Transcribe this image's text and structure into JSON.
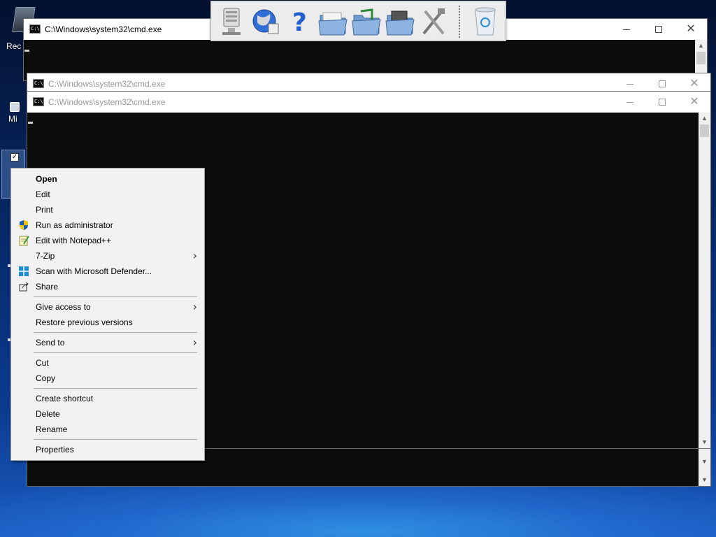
{
  "desktop": {
    "recycle_label": "Rec",
    "mi_label": "Mi"
  },
  "windows": [
    {
      "title": "C:\\Windows\\system32\\cmd.exe",
      "icon_text": "C:\\."
    },
    {
      "title": "C:\\Windows\\system32\\cmd.exe",
      "icon_text": "C:\\."
    },
    {
      "title": "C:\\Windows\\system32\\cmd.exe",
      "icon_text": "C:\\."
    }
  ],
  "window_controls": {
    "minimize": "minimize-icon",
    "maximize": "maximize-icon",
    "close": "close-icon"
  },
  "toolbar": {
    "buttons": [
      "computer-icon",
      "globe-network-icon",
      "help-icon",
      "folder-icon",
      "music-folder-icon",
      "pictures-folder-icon",
      "tools-icon",
      "recycle-bin-icon"
    ]
  },
  "context_menu": {
    "items": [
      {
        "label": "Open",
        "bold": true
      },
      {
        "label": "Edit"
      },
      {
        "label": "Print"
      },
      {
        "label": "Run as administrator",
        "icon": "shield-icon"
      },
      {
        "label": "Edit with Notepad++",
        "icon": "notepad-icon"
      },
      {
        "label": "7-Zip",
        "submenu": true
      },
      {
        "label": "Scan with Microsoft Defender...",
        "icon": "defender-icon"
      },
      {
        "label": "Share",
        "icon": "share-icon"
      },
      {
        "label": "Give access to",
        "submenu": true
      },
      {
        "label": "Restore previous versions"
      },
      {
        "label": "Send to",
        "submenu": true
      },
      {
        "label": "Cut"
      },
      {
        "label": "Copy"
      },
      {
        "label": "Create shortcut"
      },
      {
        "label": "Delete"
      },
      {
        "label": "Rename"
      },
      {
        "label": "Properties"
      }
    ],
    "submenu_arrow": "›",
    "colors": {
      "background": "#f2f2f2",
      "separator": "#a8a8a8",
      "shield_blue": "#1e5bb8",
      "shield_yellow": "#f5c400"
    }
  },
  "colors": {
    "console_bg": "#0c0c0c",
    "titlebar_bg": "#ffffff"
  }
}
